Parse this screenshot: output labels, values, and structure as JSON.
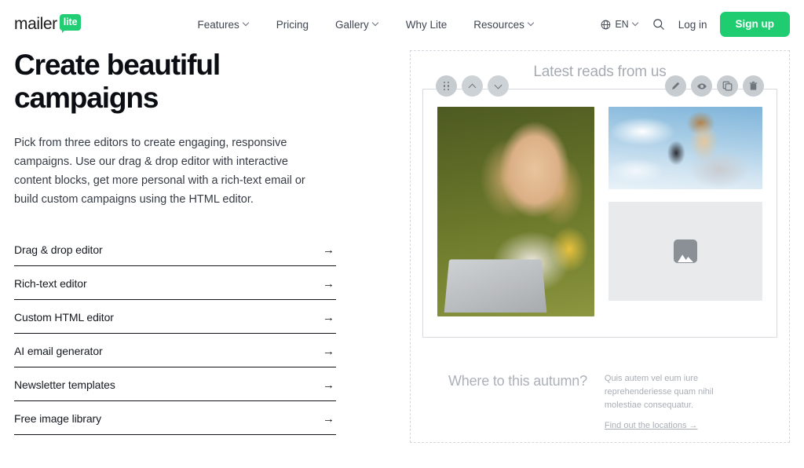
{
  "header": {
    "brand": {
      "word": "mailer",
      "badge": "lite"
    },
    "nav": [
      {
        "label": "Features",
        "has_dropdown": true
      },
      {
        "label": "Pricing",
        "has_dropdown": false
      },
      {
        "label": "Gallery",
        "has_dropdown": true
      },
      {
        "label": "Why Lite",
        "has_dropdown": false
      },
      {
        "label": "Resources",
        "has_dropdown": true
      }
    ],
    "language": {
      "code": "EN",
      "icon": "globe-icon"
    },
    "search_icon": "search-icon",
    "login_label": "Log in",
    "signup_label": "Sign up",
    "accent_color": "#1fcc70"
  },
  "hero": {
    "title": "Create beautiful campaigns",
    "paragraph": "Pick from three editors to create engaging, responsive campaigns. Use our drag & drop editor with interactive content blocks, get more personal with a rich-text email or build custom campaigns using the HTML editor.",
    "links": [
      {
        "label": "Drag & drop editor",
        "arrow": "→"
      },
      {
        "label": "Rich-text editor",
        "arrow": "→"
      },
      {
        "label": "Custom HTML editor",
        "arrow": "→"
      },
      {
        "label": "AI email generator",
        "arrow": "→"
      },
      {
        "label": "Newsletter templates",
        "arrow": "→"
      },
      {
        "label": "Free image library",
        "arrow": "→"
      }
    ]
  },
  "editor_preview": {
    "canvas_heading": "Latest reads from us",
    "toolbar_left": [
      {
        "name": "drag-handle-icon",
        "title": "Move block"
      },
      {
        "name": "chevron-up-icon",
        "title": "Move up"
      },
      {
        "name": "chevron-down-icon",
        "title": "Move down"
      }
    ],
    "toolbar_right": [
      {
        "name": "pencil-icon",
        "title": "Edit"
      },
      {
        "name": "eye-icon",
        "title": "Preview"
      },
      {
        "name": "duplicate-icon",
        "title": "Duplicate"
      },
      {
        "name": "trash-icon",
        "title": "Delete"
      }
    ],
    "images": [
      {
        "name": "photo-woman-laptop",
        "alt": "Woman smiling with sticker-covered laptop in green booth"
      },
      {
        "name": "photo-man-phone",
        "alt": "Man in grey sweatshirt looking at phone against blue sky"
      },
      {
        "name": "image-placeholder",
        "alt": "Empty image placeholder",
        "icon": "image-icon"
      }
    ],
    "text_block": {
      "heading": "Where to this autumn?",
      "paragraph": "Quis autem vel eum iure reprehenderiesse quam nihil molestiae consequatur.",
      "link": "Find out the locations →"
    }
  }
}
